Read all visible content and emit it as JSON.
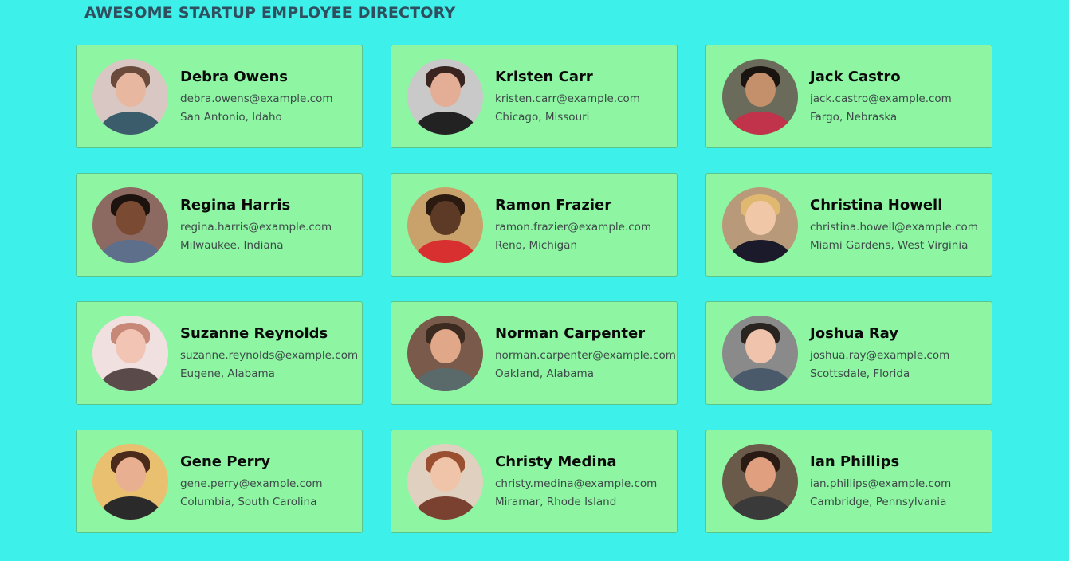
{
  "header": {
    "title": "AWESOME STARTUP EMPLOYEE DIRECTORY"
  },
  "employees": [
    {
      "name": "Debra Owens",
      "email": "debra.owens@example.com",
      "location": "San Antonio, Idaho",
      "photo": {
        "bg": "#d8c7c2",
        "skin": "#e8b7a0",
        "hair": "#6a4a3a",
        "shirt": "#3b5d6b"
      }
    },
    {
      "name": "Kristen Carr",
      "email": "kristen.carr@example.com",
      "location": "Chicago, Missouri",
      "photo": {
        "bg": "#c9c9c9",
        "skin": "#e3ad96",
        "hair": "#3a2420",
        "shirt": "#222222"
      }
    },
    {
      "name": "Jack Castro",
      "email": "jack.castro@example.com",
      "location": "Fargo, Nebraska",
      "photo": {
        "bg": "#6b6b5c",
        "skin": "#c4906c",
        "hair": "#1a1410",
        "shirt": "#c0334a"
      }
    },
    {
      "name": "Regina Harris",
      "email": "regina.harris@example.com",
      "location": "Milwaukee, Indiana",
      "photo": {
        "bg": "#8c6a62",
        "skin": "#7a4a33",
        "hair": "#1c120e",
        "shirt": "#5e6f8c"
      }
    },
    {
      "name": "Ramon Frazier",
      "email": "ramon.frazier@example.com",
      "location": "Reno, Michigan",
      "photo": {
        "bg": "#c8a26a",
        "skin": "#5c3a26",
        "hair": "#2a1a10",
        "shirt": "#d83030"
      }
    },
    {
      "name": "Christina Howell",
      "email": "christina.howell@example.com",
      "location": "Miami Gardens, West Virginia",
      "photo": {
        "bg": "#b89a7a",
        "skin": "#f0c8a8",
        "hair": "#e0b870",
        "shirt": "#1a1a2a"
      }
    },
    {
      "name": "Suzanne Reynolds",
      "email": "suzanne.reynolds@example.com",
      "location": "Eugene, Alabama",
      "photo": {
        "bg": "#f0e0e0",
        "skin": "#f2c4b4",
        "hair": "#c88878",
        "shirt": "#5a4a4a"
      }
    },
    {
      "name": "Norman Carpenter",
      "email": "norman.carpenter@example.com",
      "location": "Oakland, Alabama",
      "photo": {
        "bg": "#7a5a4a",
        "skin": "#e0a888",
        "hair": "#3a2a20",
        "shirt": "#5a6a6a"
      }
    },
    {
      "name": "Joshua Ray",
      "email": "joshua.ray@example.com",
      "location": "Scottsdale, Florida",
      "photo": {
        "bg": "#8a8a8a",
        "skin": "#f0c4ac",
        "hair": "#2a2420",
        "shirt": "#4a5a6a"
      }
    },
    {
      "name": "Gene Perry",
      "email": "gene.perry@example.com",
      "location": "Columbia, South Carolina",
      "photo": {
        "bg": "#e8c070",
        "skin": "#e8b090",
        "hair": "#4a2a1a",
        "shirt": "#2a2a2a"
      }
    },
    {
      "name": "Christy Medina",
      "email": "christy.medina@example.com",
      "location": "Miramar, Rhode Island",
      "photo": {
        "bg": "#e0d0c0",
        "skin": "#f0c4a8",
        "hair": "#9a5030",
        "shirt": "#7a4030"
      }
    },
    {
      "name": "Ian Phillips",
      "email": "ian.phillips@example.com",
      "location": "Cambridge, Pennsylvania",
      "photo": {
        "bg": "#6a5a4a",
        "skin": "#e0a080",
        "hair": "#2a1a14",
        "shirt": "#3a3a3a"
      }
    }
  ]
}
